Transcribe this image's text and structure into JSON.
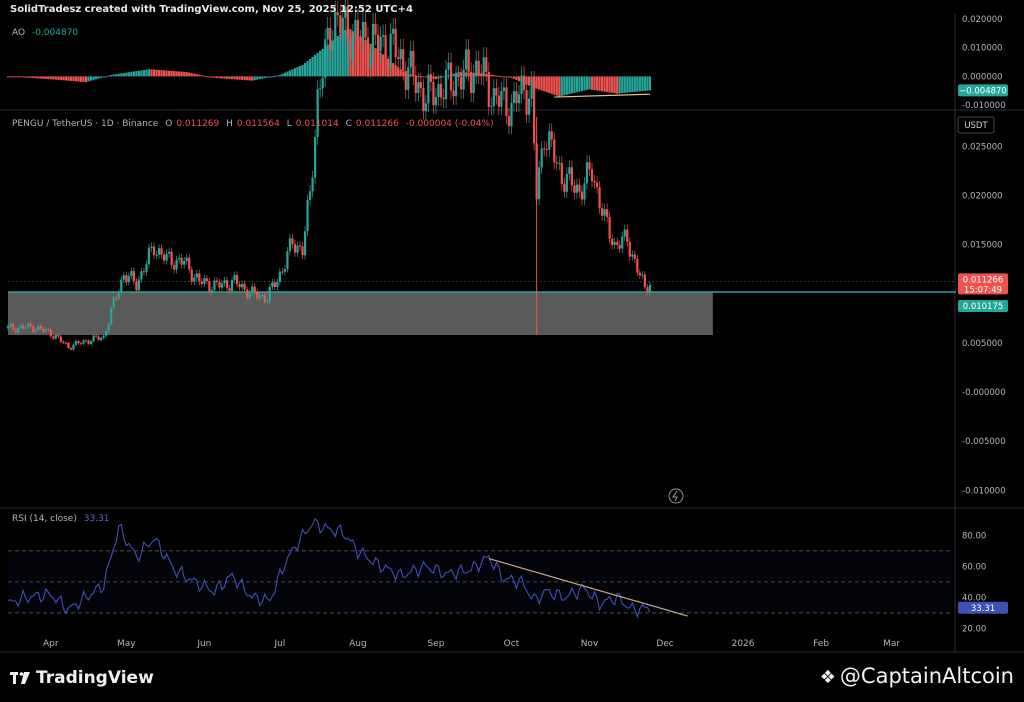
{
  "header": "SolidTradesz created with TradingView.com, Nov 25, 2025 12:52 UTC+4",
  "ao": {
    "label": "AO",
    "value": "-0.004870",
    "badge": "−0.004870",
    "ticks": [
      "0.020000",
      "0.010000",
      "0.000000",
      "-0.010000"
    ]
  },
  "main": {
    "pair": "PENGU / TetherUS · 1D · Binance",
    "o_label": "O",
    "o": "0.011269",
    "h_label": "H",
    "h": "0.011564",
    "l_label": "L",
    "l": "0.011014",
    "c_label": "C",
    "c": "0.011266",
    "chg": "-0.000004 (-0.04%)",
    "currency": "USDT",
    "price_badge": "0.011266",
    "countdown": "15:07:49",
    "level_badge": "0.010175",
    "ticks": [
      "0.025000",
      "0.020000",
      "0.015000",
      "0.005000",
      "-0.000000",
      "-0.005000",
      "-0.010000"
    ]
  },
  "rsi": {
    "label": "RSI (14, close)",
    "value": "33.31",
    "badge": "33.31",
    "ticks": [
      "80.00",
      "60.00",
      "40.00",
      "20.00"
    ]
  },
  "x_axis": [
    "Apr",
    "May",
    "Jun",
    "Jul",
    "Aug",
    "Sep",
    "Oct",
    "Nov",
    "Dec",
    "2026",
    "Feb",
    "Mar"
  ],
  "brand": "TradingView",
  "watermark": "@CaptainAltcoin",
  "colors": {
    "up": "#26a69a",
    "down": "#ef5350",
    "rsi": "#3f51b5",
    "support": "#26a69a",
    "zone": "#5a5a5a",
    "trend": "#c9a88a"
  },
  "chart_data": [
    {
      "type": "candlestick",
      "title": "PENGU / TetherUS · 1D · Binance",
      "x_range": [
        "2025-03-15",
        "2026-03-25"
      ],
      "ylim": [
        -0.0115,
        0.0285
      ],
      "support_level": 0.010175,
      "demand_zone": [
        0.0058,
        0.0102
      ],
      "close_path": [
        [
          "2025-03-15",
          0.0065
        ],
        [
          "2025-03-25",
          0.0066
        ],
        [
          "2025-04-01",
          0.006
        ],
        [
          "2025-04-08",
          0.0046
        ],
        [
          "2025-04-15",
          0.0052
        ],
        [
          "2025-04-22",
          0.0056
        ],
        [
          "2025-04-26",
          0.009
        ],
        [
          "2025-04-30",
          0.012
        ],
        [
          "2025-05-05",
          0.011
        ],
        [
          "2025-05-12",
          0.0148
        ],
        [
          "2025-05-17",
          0.0135
        ],
        [
          "2025-05-24",
          0.0132
        ],
        [
          "2025-05-30",
          0.0112
        ],
        [
          "2025-06-06",
          0.0108
        ],
        [
          "2025-06-13",
          0.0112
        ],
        [
          "2025-06-20",
          0.01
        ],
        [
          "2025-06-26",
          0.0096
        ],
        [
          "2025-07-02",
          0.0125
        ],
        [
          "2025-07-06",
          0.0152
        ],
        [
          "2025-07-10",
          0.0145
        ],
        [
          "2025-07-13",
          0.02
        ],
        [
          "2025-07-16",
          0.03
        ],
        [
          "2025-07-22",
          0.038
        ],
        [
          "2025-08-01",
          0.036
        ],
        [
          "2025-08-15",
          0.035
        ],
        [
          "2025-08-28",
          0.03
        ],
        [
          "2025-09-10",
          0.032
        ],
        [
          "2025-09-18",
          0.033
        ],
        [
          "2025-09-24",
          0.03
        ],
        [
          "2025-10-01",
          0.029
        ],
        [
          "2025-10-06",
          0.031
        ],
        [
          "2025-10-09",
          0.03
        ],
        [
          "2025-10-11",
          0.02
        ],
        [
          "2025-10-14",
          0.0265
        ],
        [
          "2025-10-21",
          0.022
        ],
        [
          "2025-10-28",
          0.0205
        ],
        [
          "2025-11-02",
          0.0225
        ],
        [
          "2025-11-07",
          0.0175
        ],
        [
          "2025-11-11",
          0.015
        ],
        [
          "2025-11-16",
          0.0155
        ],
        [
          "2025-11-20",
          0.0125
        ],
        [
          "2025-11-23",
          0.0105
        ],
        [
          "2025-11-25",
          0.011266
        ]
      ]
    },
    {
      "type": "bar",
      "title": "AO",
      "ylim": [
        -0.011,
        0.021
      ],
      "points": [
        [
          "2025-03-15",
          0.0
        ],
        [
          "2025-04-01",
          -0.001
        ],
        [
          "2025-04-15",
          -0.002
        ],
        [
          "2025-04-25",
          0.0005
        ],
        [
          "2025-05-10",
          0.0025
        ],
        [
          "2025-05-25",
          0.0015
        ],
        [
          "2025-06-05",
          -0.0005
        ],
        [
          "2025-06-20",
          -0.0015
        ],
        [
          "2025-07-01",
          0.0005
        ],
        [
          "2025-07-10",
          0.004
        ],
        [
          "2025-07-20",
          0.011
        ],
        [
          "2025-07-28",
          0.017
        ],
        [
          "2025-08-05",
          0.012
        ],
        [
          "2025-08-20",
          0.001
        ],
        [
          "2025-09-01",
          -0.001
        ],
        [
          "2025-09-10",
          0.0015
        ],
        [
          "2025-09-20",
          0.001
        ],
        [
          "2025-10-01",
          -0.0005
        ],
        [
          "2025-10-10",
          -0.004
        ],
        [
          "2025-10-20",
          -0.007
        ],
        [
          "2025-11-01",
          -0.0045
        ],
        [
          "2025-11-12",
          -0.006
        ],
        [
          "2025-11-25",
          -0.00487
        ]
      ]
    },
    {
      "type": "line",
      "title": "RSI (14, close)",
      "ylim": [
        19,
        95
      ],
      "guides": [
        70,
        50,
        30
      ],
      "points": [
        [
          "2025-03-15",
          36
        ],
        [
          "2025-03-22",
          40
        ],
        [
          "2025-04-01",
          42
        ],
        [
          "2025-04-08",
          32
        ],
        [
          "2025-04-15",
          40
        ],
        [
          "2025-04-22",
          48
        ],
        [
          "2025-04-28",
          85
        ],
        [
          "2025-05-05",
          66
        ],
        [
          "2025-05-12",
          78
        ],
        [
          "2025-05-20",
          58
        ],
        [
          "2025-05-28",
          50
        ],
        [
          "2025-06-05",
          44
        ],
        [
          "2025-06-12",
          54
        ],
        [
          "2025-06-20",
          40
        ],
        [
          "2025-06-27",
          38
        ],
        [
          "2025-07-03",
          62
        ],
        [
          "2025-07-08",
          75
        ],
        [
          "2025-07-14",
          88
        ],
        [
          "2025-07-20",
          84
        ],
        [
          "2025-07-26",
          82
        ],
        [
          "2025-08-01",
          70
        ],
        [
          "2025-08-08",
          62
        ],
        [
          "2025-08-18",
          54
        ],
        [
          "2025-08-28",
          60
        ],
        [
          "2025-09-05",
          55
        ],
        [
          "2025-09-15",
          58
        ],
        [
          "2025-09-22",
          66
        ],
        [
          "2025-09-28",
          52
        ],
        [
          "2025-10-05",
          50
        ],
        [
          "2025-10-10",
          38
        ],
        [
          "2025-10-15",
          44
        ],
        [
          "2025-10-22",
          40
        ],
        [
          "2025-10-30",
          46
        ],
        [
          "2025-11-05",
          36
        ],
        [
          "2025-11-12",
          40
        ],
        [
          "2025-11-18",
          32
        ],
        [
          "2025-11-25",
          33.31
        ]
      ]
    }
  ]
}
